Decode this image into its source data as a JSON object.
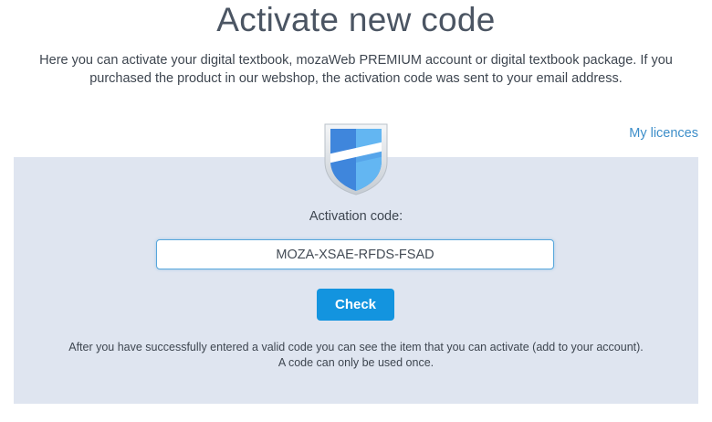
{
  "header": {
    "title": "Activate new code",
    "intro": "Here you can activate your digital textbook, mozaWeb PREMIUM account or digital textbook package. If you purchased the product in our webshop, the activation code was sent to your email address."
  },
  "links": {
    "my_licences": "My licences"
  },
  "activation": {
    "icon": "shield-icon",
    "label": "Activation code:",
    "code_value": "MOZA-XSAE-RFDS-FSAD",
    "check_label": "Check",
    "note_line1": "After you have successfully entered a valid code you can see the item that you can activate (add to your account).",
    "note_line2": "A code can only be used once."
  },
  "colors": {
    "accent": "#1394df",
    "link": "#3d8ec9",
    "panel_bg": "#dfe5f0",
    "shield_blue": "#3f86dc",
    "shield_light": "#63b6f2"
  }
}
